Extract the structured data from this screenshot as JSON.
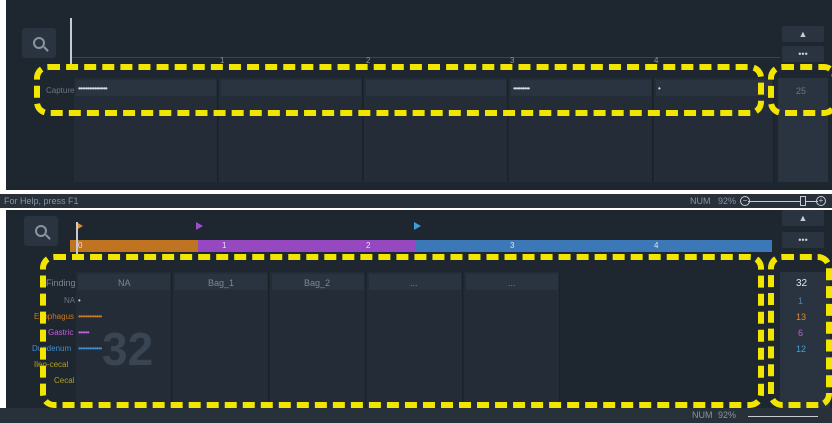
{
  "status": {
    "help_text": "For Help, press F1",
    "num": "NUM",
    "zoom": "92%"
  },
  "top": {
    "ruler_labels": [
      "1",
      "2",
      "3",
      "4"
    ],
    "row_label": "Capture",
    "cells": [
      {
        "dots": "••••••••••••••••"
      },
      {
        "dots": ""
      },
      {
        "dots": ""
      },
      {
        "dots": "•••••••••"
      },
      {
        "dots": "•"
      }
    ],
    "right_value": "25",
    "up_button": "▲",
    "more_button": "•••"
  },
  "bottom": {
    "segments": [
      {
        "label": "0",
        "color": "#c87a22",
        "fraction": 0.17
      },
      {
        "label": "1",
        "color": "#9b4fc8",
        "fraction": 0.31
      },
      {
        "label": "2",
        "color": "#9b4fc8",
        "fraction": 0
      },
      {
        "label": "3",
        "color": "#3f7ec0",
        "fraction": 0.52
      },
      {
        "label": "4",
        "color": "#3f7ec0",
        "fraction": 0
      }
    ],
    "segment_labels": [
      "0",
      "1",
      "2",
      "3",
      "4"
    ],
    "columns": [
      "Findings",
      "NA",
      "Bag_1",
      "Bag_2",
      "...",
      "..."
    ],
    "rows": [
      {
        "label": "NA",
        "color": "#c8ccd2",
        "dots": "•"
      },
      {
        "label": "Esophagus",
        "color": "#c87a22",
        "dots": "•••••••••••••"
      },
      {
        "label": "Gastric",
        "color": "#c060d8",
        "dots": "••••••"
      },
      {
        "label": "Duodenum",
        "color": "#3f8ed0",
        "dots": "•••••••••••••"
      },
      {
        "label": "Ileo-cecal",
        "color": "#b0a020",
        "dots": ""
      },
      {
        "label": "Cecal",
        "color": "#b0a020",
        "dots": ""
      }
    ],
    "big_number": "32",
    "total": "32",
    "counts": [
      {
        "value": "1",
        "color": "#5a7fa0"
      },
      {
        "value": "13",
        "color": "#e08a2a"
      },
      {
        "value": "6",
        "color": "#c060d8"
      },
      {
        "value": "12",
        "color": "#3f9ed8"
      }
    ],
    "up_button": "▲",
    "more_button": "•••"
  }
}
